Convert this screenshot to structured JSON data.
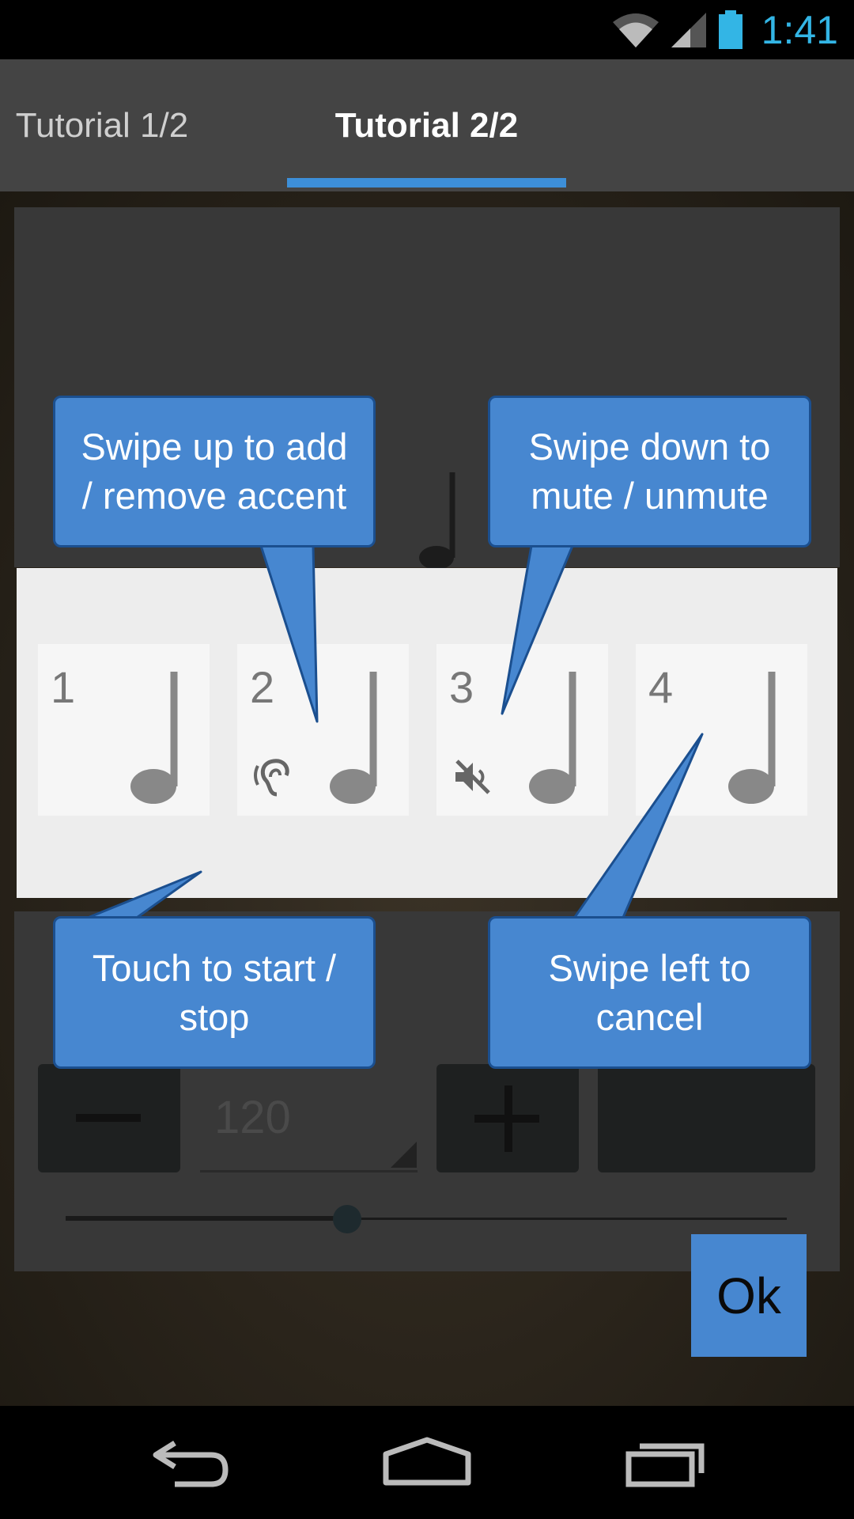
{
  "status_bar": {
    "time": "1:41",
    "icons": [
      "wifi-icon",
      "signal-icon",
      "battery-icon"
    ],
    "accent_color": "#33b5e5"
  },
  "tabs": [
    {
      "label": "Tutorial 1/2",
      "selected": false
    },
    {
      "label": "Tutorial 2/2",
      "selected": true
    }
  ],
  "tab_indicator_color": "#3d8fd8",
  "beats": [
    {
      "number": "1",
      "state": "normal"
    },
    {
      "number": "2",
      "state": "accent",
      "badge_icon": "ear-icon"
    },
    {
      "number": "3",
      "state": "muted",
      "badge_icon": "mute-icon"
    },
    {
      "number": "4",
      "state": "normal"
    }
  ],
  "callouts": {
    "accent": {
      "line1": "Swipe up to add",
      "line2": "/ remove accent"
    },
    "mute": {
      "line1": "Swipe down to",
      "line2": "mute / unmute"
    },
    "start_stop": {
      "line1": "Touch to start /",
      "line2": "stop"
    },
    "cancel": {
      "line1": "Swipe left to",
      "line2": "cancel"
    },
    "color": "#4787d0"
  },
  "background_app": {
    "bpm_value": "120",
    "slider_fraction": 0.39
  },
  "ok_button": {
    "label": "Ok"
  },
  "nav_bar": {
    "icons": [
      "back-icon",
      "home-icon",
      "recents-icon"
    ]
  }
}
